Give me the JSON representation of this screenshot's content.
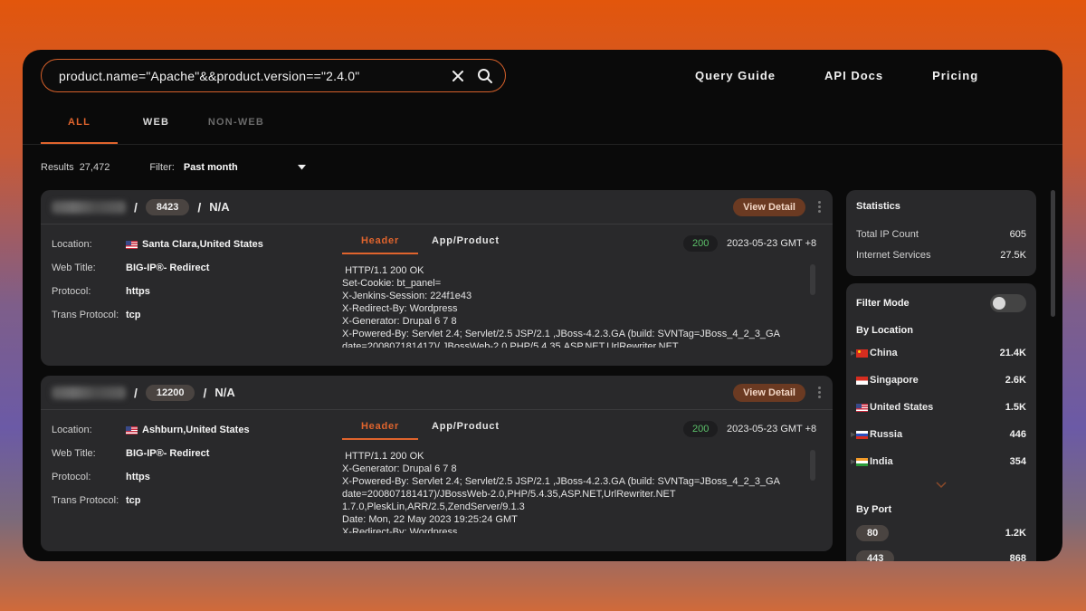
{
  "search": {
    "query": "product.name=\"Apache\"&&product.version==\"2.4.0\""
  },
  "nav": {
    "query_guide": "Query Guide",
    "api_docs": "API Docs",
    "pricing": "Pricing"
  },
  "tabs": {
    "all": "ALL",
    "web": "WEB",
    "non_web": "NON-WEB"
  },
  "results": {
    "label": "Results",
    "count": "27,472",
    "filter_label": "Filter:",
    "filter_value": "Past month"
  },
  "labels": {
    "location": "Location:",
    "web_title": "Web Title:",
    "protocol": "Protocol:",
    "trans_protocol": "Trans Protocol:",
    "header_tab": "Header",
    "app_tab": "App/Product",
    "view_detail": "View Detail",
    "slash": "/"
  },
  "cards": [
    {
      "port": "8423",
      "na": "N/A",
      "location": "Santa Clara,United States",
      "web_title": "BIG-IP®- Redirect",
      "protocol": "https",
      "trans_protocol": "tcp",
      "status": "200",
      "date": "2023-05-23 GMT +8",
      "response": " HTTP/1.1 200 OK\nSet-Cookie: bt_panel=\nX-Jenkins-Session: 224f1e43\nX-Redirect-By: Wordpress\nX-Generator: Drupal 6 7 8\nX-Powered-By: Servlet 2.4; Servlet/2.5 JSP/2.1 ,JBoss-4.2.3.GA (build: SVNTag=JBoss_4_2_3_GA date=200807181417)/,JBossWeb-2.0,PHP/5.4.35,ASP.NET,UrlRewriter.NET"
    },
    {
      "port": "12200",
      "na": "N/A",
      "location": "Ashburn,United States",
      "web_title": "BIG-IP®- Redirect",
      "protocol": "https",
      "trans_protocol": "tcp",
      "status": "200",
      "date": "2023-05-23 GMT +8",
      "response": " HTTP/1.1 200 OK\nX-Generator: Drupal 6 7 8\nX-Powered-By: Servlet 2.4; Servlet/2.5 JSP/2.1 ,JBoss-4.2.3.GA (build: SVNTag=JBoss_4_2_3_GA date=200807181417)/JBossWeb-2.0,PHP/5.4.35,ASP.NET,UrlRewriter.NET 1.7.0,PleskLin,ARR/2.5,ZendServer/9.1.3\nDate: Mon, 22 May 2023 19:25:24 GMT\nX-Redirect-By: Wordpress"
    }
  ],
  "statistics": {
    "title": "Statistics",
    "total_ip_label": "Total IP Count",
    "total_ip": "605",
    "internet_services_label": "Internet Services",
    "internet_services": "27.5K"
  },
  "filter_mode": {
    "title": "Filter Mode",
    "by_location": "By Location",
    "locations": [
      {
        "name": "China",
        "count": "21.4K"
      },
      {
        "name": "Singapore",
        "count": "2.6K"
      },
      {
        "name": "United States",
        "count": "1.5K"
      },
      {
        "name": "Russia",
        "count": "446"
      },
      {
        "name": "India",
        "count": "354"
      }
    ],
    "by_port": "By Port",
    "ports": [
      {
        "port": "80",
        "count": "1.2K"
      },
      {
        "port": "443",
        "count": "868"
      }
    ]
  },
  "colors": {
    "accent": "#e0642d",
    "status_ok": "#5cc16a",
    "card_bg": "#29292b"
  }
}
